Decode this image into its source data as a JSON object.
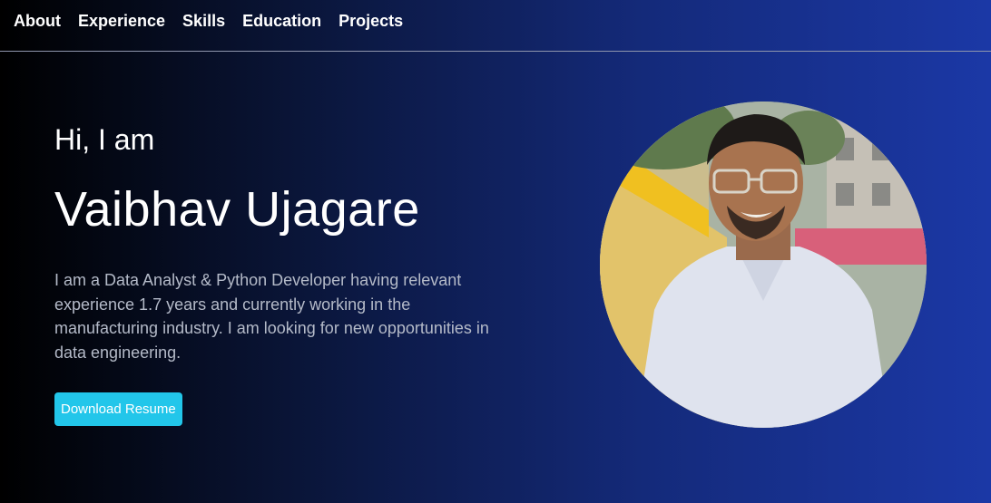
{
  "nav": {
    "items": [
      "About",
      "Experience",
      "Skills",
      "Education",
      "Projects"
    ]
  },
  "hero": {
    "greeting": "Hi, I am",
    "name": "Vaibhav Ujagare",
    "bio": "I am a Data Analyst & Python Developer having relevant experience 1.7 years and currently working in the manufacturing industry. I am looking for new opportunities in data engineering.",
    "button_label": "Download Resume"
  },
  "colors": {
    "accent": "#22c6ea",
    "bg_left": "#000000",
    "bg_right": "#1b38a6"
  }
}
